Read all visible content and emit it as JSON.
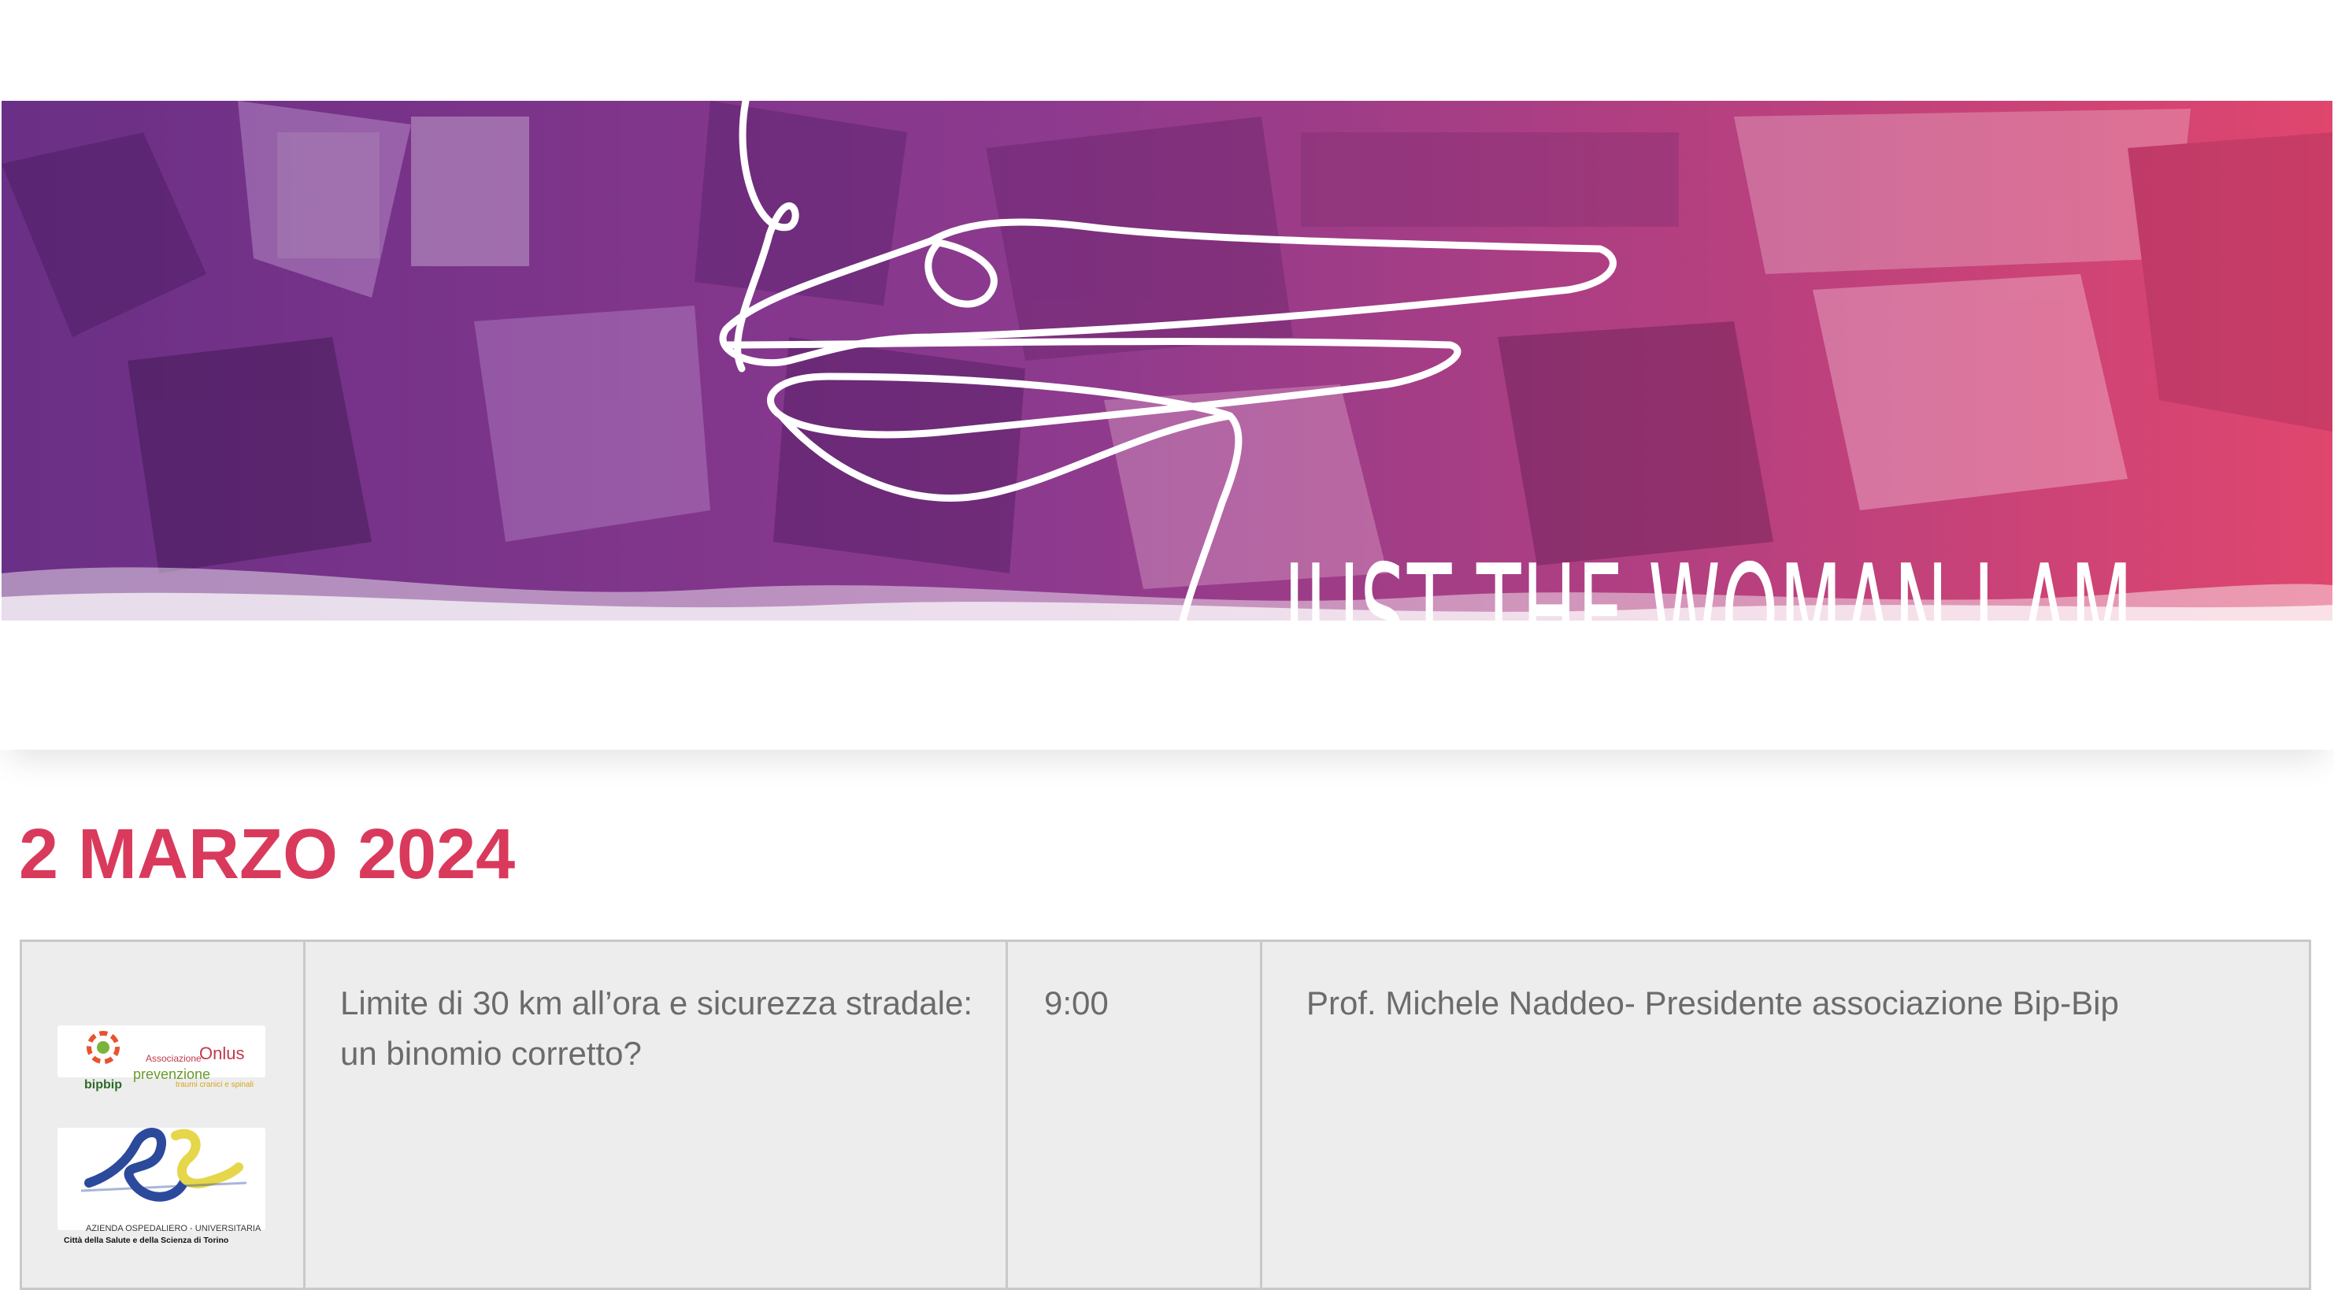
{
  "banner": {
    "title": "JUST THE WOMAN I AM",
    "colors": {
      "left": "#6a2f86",
      "mid": "#a03a8a",
      "right": "#e0466e"
    }
  },
  "section": {
    "date_heading": "2 MARZO 2024",
    "accent_color": "#d93a5c"
  },
  "program": {
    "rows": [
      {
        "logos": [
          {
            "name": "bipbip-logo",
            "lines": [
              "Associazione",
              "Onlus",
              "prevenzione",
              "traumi cranici e spinali",
              "bipbip"
            ]
          },
          {
            "name": "aou-citta-salute-logo",
            "lines": [
              "AZIENDA OSPEDALIERO - UNIVERSITARIA",
              "Città della Salute e della Scienza di Torino"
            ]
          }
        ],
        "title": " Limite di 30 km all’ora e sicurezza stradale: un binomio corretto?",
        "time": "9:00",
        "speaker": "Prof. Michele Naddeo- Presidente associazione Bip-Bip"
      }
    ]
  }
}
